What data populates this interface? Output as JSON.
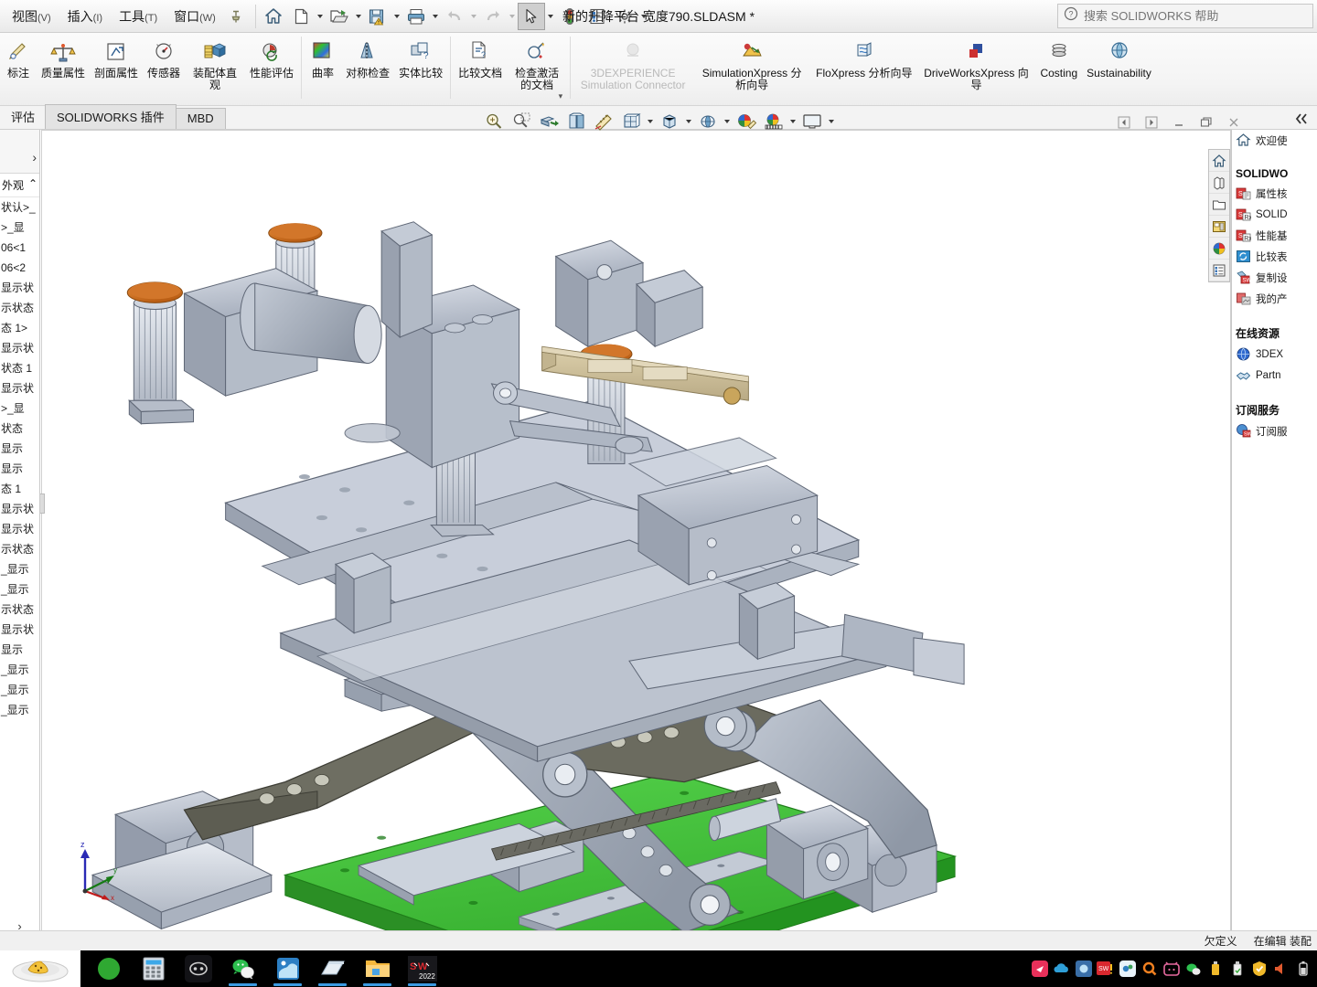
{
  "window": {
    "title": "新的升降平台 宽度790.SLDASM *",
    "menus": [
      {
        "label": "视图",
        "mnemonic": "(V)",
        "name": "menu-view"
      },
      {
        "label": "插入",
        "mnemonic": "(I)",
        "name": "menu-insert"
      },
      {
        "label": "工具",
        "mnemonic": "(T)",
        "name": "menu-tools"
      },
      {
        "label": "窗口",
        "mnemonic": "(W)",
        "name": "menu-window"
      }
    ],
    "pin_icon": "pin-icon",
    "quick_access": [
      {
        "icon": "home-icon",
        "name": "home-button",
        "caret": false
      },
      {
        "icon": "new-document-icon",
        "name": "new-document-button",
        "caret": true
      },
      {
        "icon": "open-folder-icon",
        "name": "open-button",
        "caret": true
      },
      {
        "icon": "save-warning-icon",
        "name": "save-button",
        "caret": true
      },
      {
        "icon": "print-icon",
        "name": "print-button",
        "caret": true
      },
      {
        "icon": "undo-icon",
        "name": "undo-button",
        "caret": true,
        "disabled": true
      },
      {
        "icon": "redo-icon",
        "name": "redo-button",
        "caret": true,
        "disabled": true
      },
      {
        "icon": "select-cursor-icon",
        "name": "select-button",
        "caret": true,
        "active": true
      },
      {
        "icon": "rebuild-traffic-light-icon",
        "name": "rebuild-button",
        "caret": false
      },
      {
        "icon": "options-list-icon",
        "name": "file-properties-button",
        "caret": false
      },
      {
        "icon": "gear-icon",
        "name": "options-button",
        "caret": true
      }
    ],
    "search": {
      "placeholder": "搜索 SOLIDWORKS 帮助",
      "icon": "help-question-icon"
    }
  },
  "ribbon": {
    "groups": [
      {
        "name": "evaluate-core-group",
        "items": [
          {
            "label": "标注",
            "icon": "markup-icon",
            "name": "ribbon-markup"
          },
          {
            "label": "质量属性",
            "icon": "mass-properties-icon",
            "name": "ribbon-mass-properties"
          },
          {
            "label": "剖面属性",
            "icon": "section-properties-icon",
            "name": "ribbon-section-properties"
          },
          {
            "label": "传感器",
            "icon": "sensor-icon",
            "name": "ribbon-sensor"
          },
          {
            "label": "装配体直观",
            "icon": "assembly-visualization-icon",
            "name": "ribbon-assembly-visualization"
          },
          {
            "label": "性能评估",
            "icon": "performance-evaluation-icon",
            "name": "ribbon-performance-evaluation"
          }
        ]
      },
      {
        "name": "geometry-check-group",
        "items": [
          {
            "label": "曲率",
            "icon": "curvature-icon",
            "name": "ribbon-curvature"
          },
          {
            "label": "对称检查",
            "icon": "symmetry-check-icon",
            "name": "ribbon-symmetry-check"
          },
          {
            "label": "实体比较",
            "icon": "geometry-compare-icon",
            "name": "ribbon-geometry-compare"
          }
        ]
      },
      {
        "name": "compare-group",
        "items": [
          {
            "label": "比较文档",
            "icon": "compare-documents-icon",
            "name": "ribbon-compare-documents"
          },
          {
            "label": "检查激活的文档",
            "icon": "check-active-document-icon",
            "name": "ribbon-check-active-document",
            "more": true
          }
        ]
      },
      {
        "name": "xpress-group",
        "items": [
          {
            "label": "3DEXPERIENCE Simulation Connector",
            "icon": "3dexperience-simulation-icon",
            "name": "ribbon-3dexperience-simulation-connector",
            "disabled": true,
            "wide": true
          },
          {
            "label": "SimulationXpress 分析向导",
            "icon": "simulationxpress-icon",
            "name": "ribbon-simulationxpress-wizard",
            "wide": true
          },
          {
            "label": "FloXpress 分析向导",
            "icon": "floxpress-icon",
            "name": "ribbon-floxpress-wizard",
            "wide": true
          },
          {
            "label": "DriveWorksXpress 向导",
            "icon": "driveworksxpress-icon",
            "name": "ribbon-driveworksxpress-wizard",
            "wide": true
          },
          {
            "label": "Costing",
            "icon": "costing-icon",
            "name": "ribbon-costing",
            "wide": true
          },
          {
            "label": "Sustainability",
            "icon": "sustainability-icon",
            "name": "ribbon-sustainability",
            "wide": true
          }
        ]
      }
    ]
  },
  "tabs": {
    "items": [
      {
        "label": "评估",
        "name": "tab-evaluate",
        "active": true,
        "plain": true
      },
      {
        "label": "SOLIDWORKS 插件",
        "name": "tab-solidworks-addins",
        "active": false
      },
      {
        "label": "MBD",
        "name": "tab-mbd",
        "active": false
      }
    ]
  },
  "view_toolbar": {
    "items": [
      {
        "icon": "zoom-to-fit-icon",
        "name": "zoom-to-fit-button",
        "caret": false
      },
      {
        "icon": "zoom-to-area-icon",
        "name": "zoom-to-area-button",
        "caret": false
      },
      {
        "icon": "section-view-icon",
        "name": "section-view-button",
        "caret": false
      },
      {
        "icon": "view-orientation-icon",
        "name": "view-orientation-button",
        "caret": false
      },
      {
        "icon": "measure-icon",
        "name": "measure-button",
        "caret": false
      },
      {
        "icon": "display-style-icon",
        "name": "display-style-button",
        "caret": true
      },
      {
        "icon": "hide-show-icon",
        "name": "hide-show-items-button",
        "caret": true
      },
      {
        "icon": "apply-scene-icon",
        "name": "apply-scene-button",
        "caret": true
      },
      {
        "icon": "edit-appearance-icon",
        "name": "edit-appearance-button",
        "caret": false
      },
      {
        "icon": "render-tools-icon",
        "name": "render-tools-button",
        "caret": true
      },
      {
        "icon": "viewport-icon",
        "name": "viewport-button",
        "caret": true
      }
    ],
    "window_controls": [
      {
        "icon": "previous-view-icon",
        "name": "previous-window-button"
      },
      {
        "icon": "next-view-icon",
        "name": "next-window-button"
      },
      {
        "icon": "minimize-icon",
        "name": "minimize-document-button"
      },
      {
        "icon": "restore-icon",
        "name": "restore-document-button"
      },
      {
        "icon": "close-icon",
        "name": "close-document-button"
      }
    ],
    "collapse_icon": "collapse-panel-icon"
  },
  "feature_tree": {
    "expand_icon": "expand-tree-icon",
    "header": "外观",
    "rows": [
      "状认>_",
      ">_显",
      "06<1",
      "06<2",
      "显示状",
      "示状态",
      "态 1>",
      "显示状",
      "状态 1",
      "显示状",
      ">_显",
      "状态",
      "显示",
      "显示",
      "态 1",
      "显示状",
      "显示状",
      "示状态",
      "_显示",
      "_显示",
      "示状态",
      "显示状",
      "显示",
      "_显示",
      "_显示",
      "_显示"
    ],
    "footer_icon": "scroll-right-icon"
  },
  "task_pane": {
    "toolbar": [
      {
        "icon": "home-icon",
        "name": "task-home-button"
      },
      {
        "icon": "design-library-icon",
        "name": "task-design-library-button"
      },
      {
        "icon": "file-explorer-icon",
        "name": "task-file-explorer-button"
      },
      {
        "icon": "view-palette-icon",
        "name": "task-view-palette-button"
      },
      {
        "icon": "appearances-icon",
        "name": "task-appearances-button"
      },
      {
        "icon": "custom-properties-icon",
        "name": "task-custom-properties-button"
      }
    ],
    "welcome": {
      "label": "欢迎使",
      "icon": "home-icon",
      "name": "task-welcome-link"
    },
    "sections": [
      {
        "title": "SOLIDWO",
        "name": "section-solidworks-tools",
        "items": [
          {
            "label": "属性核",
            "icon": "property-tab-builder-icon",
            "name": "tool-property-tab-builder"
          },
          {
            "label": "SOLID",
            "icon": "solidworks-rx-icon",
            "name": "tool-solidworks-rx"
          },
          {
            "label": "性能基",
            "icon": "performance-benchmark-icon",
            "name": "tool-performance-benchmark"
          },
          {
            "label": "比较表",
            "icon": "compare-icon",
            "name": "tool-compare"
          },
          {
            "label": "复制设",
            "icon": "copy-settings-icon",
            "name": "tool-copy-settings-wizard"
          },
          {
            "label": "我的产",
            "icon": "my-products-icon",
            "name": "tool-my-products"
          }
        ]
      },
      {
        "title": "在线资源",
        "name": "section-online-resources",
        "items": [
          {
            "label": "3DEX",
            "icon": "3dexperience-globe-icon",
            "name": "link-3dexperience"
          },
          {
            "label": "Partn",
            "icon": "partner-handshake-icon",
            "name": "link-partner-solutions"
          }
        ]
      },
      {
        "title": "订阅服务",
        "name": "section-subscription",
        "items": [
          {
            "label": "订阅服",
            "icon": "subscription-icon",
            "name": "link-subscription-services"
          }
        ]
      }
    ]
  },
  "status_bar": {
    "items": [
      "欠定义",
      "在编辑 装配"
    ]
  },
  "taskbar": {
    "start_icon": "start-plate-icon",
    "apps": [
      {
        "icon": "browser-360-icon",
        "name": "taskbar-360-browser",
        "running": false
      },
      {
        "icon": "calculator-icon",
        "name": "taskbar-calculator",
        "running": false
      },
      {
        "icon": "discord-icon",
        "name": "taskbar-discord",
        "running": false
      },
      {
        "icon": "wechat-icon",
        "name": "taskbar-wechat",
        "running": true
      },
      {
        "icon": "media-app-icon",
        "name": "taskbar-media-app",
        "running": true
      },
      {
        "icon": "notes-icon",
        "name": "taskbar-notes",
        "running": true
      },
      {
        "icon": "file-explorer-icon",
        "name": "taskbar-file-explorer",
        "running": true
      },
      {
        "icon": "solidworks-2022-icon",
        "name": "taskbar-solidworks-2022",
        "running": true
      }
    ],
    "tray": [
      {
        "icon": "red-app-icon",
        "name": "tray-red-app"
      },
      {
        "icon": "onedrive-cloud-icon",
        "name": "tray-onedrive"
      },
      {
        "icon": "blue-tool-icon",
        "name": "tray-blue-tool"
      },
      {
        "icon": "solidworks-alert-icon",
        "name": "tray-solidworks-alert"
      },
      {
        "icon": "settings-sync-icon",
        "name": "tray-settings-sync"
      },
      {
        "icon": "search-magnifier-icon",
        "name": "tray-search"
      },
      {
        "icon": "bilibili-icon",
        "name": "tray-bilibili"
      },
      {
        "icon": "wechat-icon",
        "name": "tray-wechat"
      },
      {
        "icon": "usb-drive-icon",
        "name": "tray-usb-drive"
      },
      {
        "icon": "safe-eject-icon",
        "name": "tray-safe-eject"
      },
      {
        "icon": "shield-icon",
        "name": "tray-security-shield"
      },
      {
        "icon": "volume-icon",
        "name": "tray-volume"
      },
      {
        "icon": "battery-icon",
        "name": "tray-battery"
      }
    ]
  },
  "model": {
    "name": "scissor-lift-assembly",
    "triad": {
      "x_label": "x",
      "y_label": "y",
      "z_label": "z"
    },
    "colors": {
      "base_plate": "#3cb936",
      "steel_light": "#b9c0cc",
      "steel_mid": "#9aa2b0",
      "steel_dark": "#6e7480",
      "arm_dark": "#6a6a5f",
      "orange_cap": "#d4761f",
      "tan_rail": "#c9bc9a"
    }
  }
}
